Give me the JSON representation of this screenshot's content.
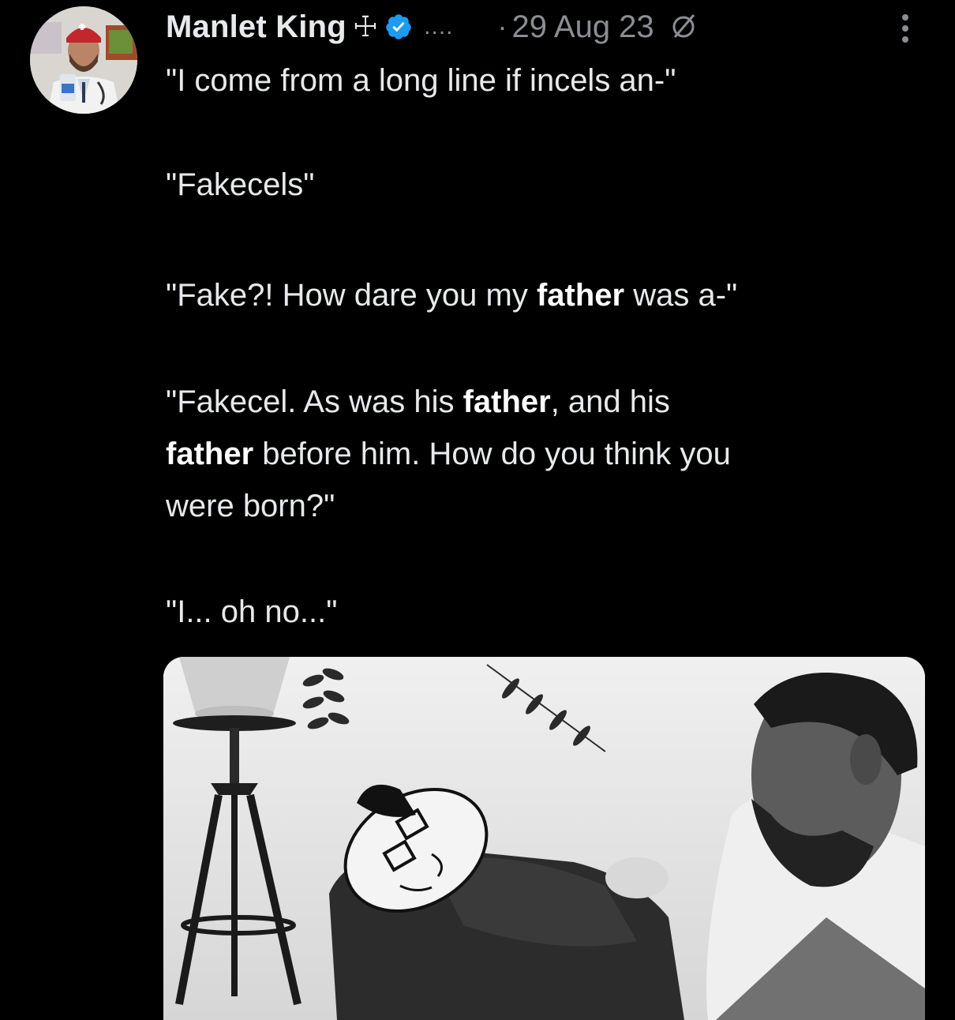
{
  "author": {
    "display_name": "Manlet King",
    "name_symbol": "☩",
    "truncation": "....",
    "separator": "·",
    "timestamp": "29 Aug 23",
    "verified": true
  },
  "tweet": {
    "line1": "\"I come from a long line if incels an-\"",
    "line2": "\"Fakecels\"",
    "line3_pre": "\"Fake?! How dare you my ",
    "line3_bold": "father",
    "line3_post": " was a-\"",
    "line4_a": "\"Fakecel. As was his ",
    "line4_b": "father",
    "line4_c": ", and his",
    "line4_d": "father",
    "line4_e": " before him. How do you think you",
    "line4_f": "were born?\"",
    "line5": "\"I... oh no...\""
  },
  "colors": {
    "background": "#000000",
    "text": "#e7e9ea",
    "muted": "#8b8f94",
    "verified_blue": "#1d9bf0"
  },
  "icons": {
    "verified": "verified-badge-icon",
    "edited": "edit-history-icon",
    "more": "more-options-icon"
  }
}
